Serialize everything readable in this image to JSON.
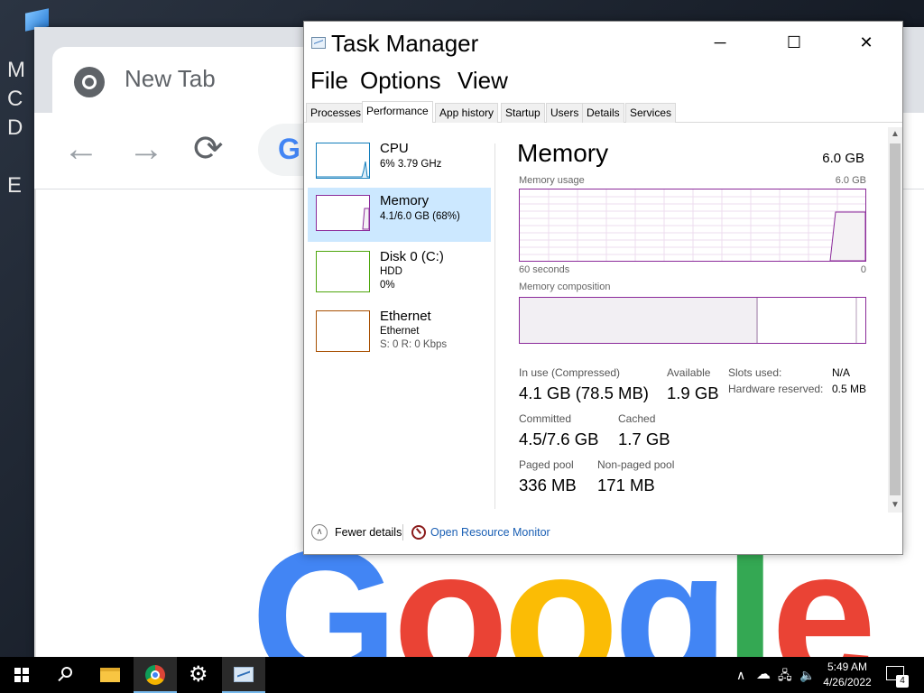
{
  "desktop": {
    "side_glyphs": "M\nC\nD\n\nE"
  },
  "chrome": {
    "tab_title": "New Tab",
    "back_label": "←",
    "forward_label": "→",
    "reload_label": "⟳",
    "omnibox_glyph": "G",
    "logo_letters": [
      "G",
      "o",
      "o",
      "g",
      "l",
      "e"
    ],
    "logo_colors": [
      "#4285f4",
      "#ea4335",
      "#fbbc05",
      "#4285f4",
      "#34a853",
      "#ea4335"
    ]
  },
  "task_manager": {
    "title": "Task Manager",
    "window_buttons": {
      "minimize": "─",
      "maximize": "☐",
      "close": "✕"
    },
    "menu": [
      "File",
      "Options",
      "View"
    ],
    "tabs": [
      "Processes",
      "Performance",
      "App history",
      "Startup",
      "Users",
      "Details",
      "Services"
    ],
    "active_tab": "Performance",
    "resources": [
      {
        "name": "CPU",
        "line1": "6%  3.79 GHz",
        "line2": "",
        "color": "#117dbb"
      },
      {
        "name": "Memory",
        "line1": "4.1/6.0 GB (68%)",
        "line2": "",
        "color": "#8b2a9a",
        "selected": true
      },
      {
        "name": "Disk 0 (C:)",
        "line1": "HDD",
        "line2": "0%",
        "color": "#4da60c"
      },
      {
        "name": "Ethernet",
        "line1": "Ethernet",
        "line2": "S: 0  R: 0 Kbps",
        "color": "#a74f01"
      }
    ],
    "memory": {
      "title": "Memory",
      "total": "6.0 GB",
      "usage_label": "Memory usage",
      "usage_max": "6.0 GB",
      "time_left": "60 seconds",
      "time_right": "0",
      "composition_label": "Memory composition",
      "in_use_label": "In use (Compressed)",
      "in_use_value": "4.1 GB (78.5 MB)",
      "available_label": "Available",
      "available_value": "1.9 GB",
      "committed_label": "Committed",
      "committed_value": "4.5/7.6 GB",
      "cached_label": "Cached",
      "cached_value": "1.7 GB",
      "paged_label": "Paged pool",
      "paged_value": "336 MB",
      "nonpaged_label": "Non-paged pool",
      "nonpaged_value": "171 MB",
      "slots_label": "Slots used:",
      "slots_value": "N/A",
      "hw_reserved_label": "Hardware reserved:",
      "hw_reserved_value": "0.5 MB"
    },
    "footer": {
      "fewer_details": "Fewer details",
      "open_resource_monitor": "Open Resource Monitor"
    }
  },
  "taskbar": {
    "tray_chevron": "∧",
    "time": "5:49 AM",
    "date": "4/26/2022",
    "notification_count": "4"
  }
}
